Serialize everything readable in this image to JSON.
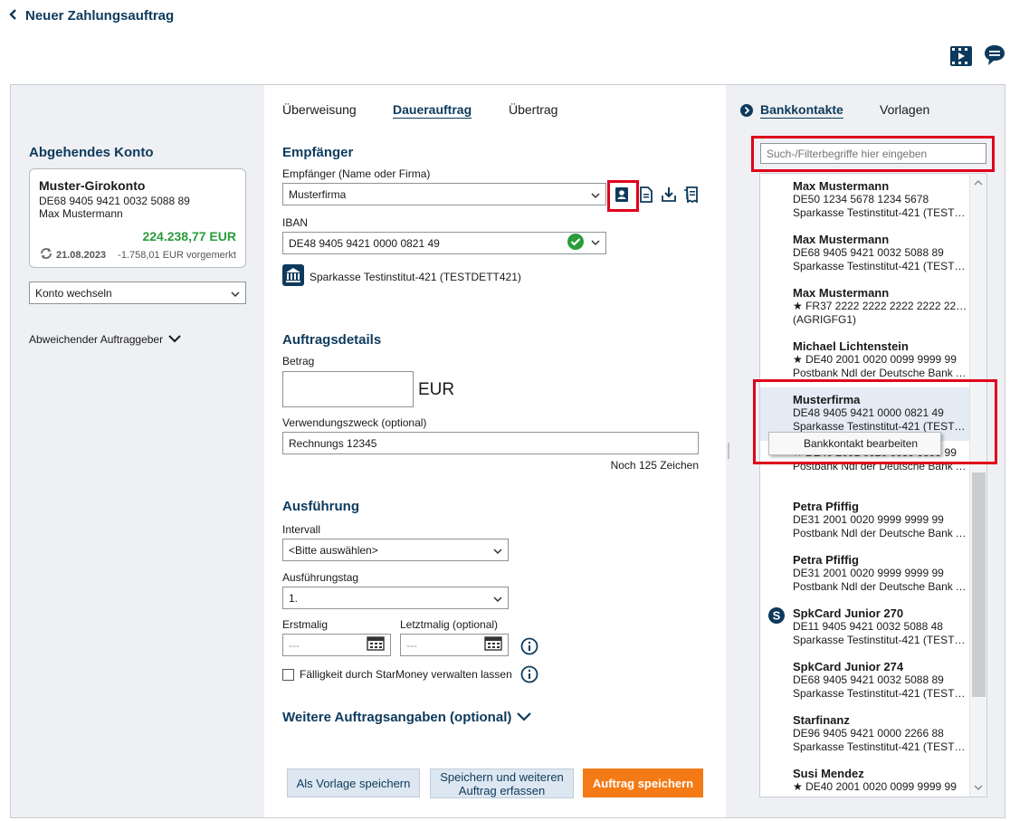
{
  "header": {
    "title": "Neuer Zahlungsauftrag"
  },
  "left": {
    "title": "Abgehendes Konto",
    "account": {
      "name": "Muster-Girokonto",
      "iban": "DE68 9405 9421 0032 5088 89",
      "owner": "Max Mustermann",
      "balance": "224.238,77 EUR",
      "date": "21.08.2023",
      "pending": "-1.758,01 EUR vorgemerkt"
    },
    "switch_label": "Konto wechseln",
    "alt_payer_label": "Abweichender Auftraggeber"
  },
  "tabs": [
    "Überweisung",
    "Dauerauftrag",
    "Übertrag"
  ],
  "recipient": {
    "section_title": "Empfänger",
    "name_label": "Empfänger (Name oder Firma)",
    "name_value": "Musterfirma",
    "iban_label": "IBAN",
    "iban_value": "DE48 9405 9421 0000 0821 49",
    "bank": "Sparkasse Testinstitut-421 (TESTDETT421)"
  },
  "details": {
    "section_title": "Auftragsdetails",
    "amount_label": "Betrag",
    "amount_value": "",
    "currency": "EUR",
    "purpose_label": "Verwendungszweck (optional)",
    "purpose_value": "Rechnungs 12345",
    "chars_left": "Noch 125 Zeichen"
  },
  "execution": {
    "section_title": "Ausführung",
    "interval_label": "Intervall",
    "interval_value": "<Bitte auswählen>",
    "day_label": "Ausführungstag",
    "day_value": "1.",
    "first_label": "Erstmalig",
    "first_value": "---",
    "last_label": "Letztmalig (optional)",
    "last_value": "---",
    "starmoney_label": "Fälligkeit durch StarMoney verwalten lassen"
  },
  "more_label": "Weitere Auftragsangaben (optional)",
  "buttons": {
    "template": "Als Vorlage speichern",
    "save_more_line1": "Speichern und weiteren",
    "save_more_line2": "Auftrag erfassen",
    "save": "Auftrag speichern"
  },
  "right": {
    "tabs": [
      "Bankkontakte",
      "Vorlagen"
    ],
    "search_placeholder": "Such-/Filterbegriffe hier eingeben",
    "contacts": [
      {
        "name": "Max Mustermann",
        "line1": "DE50 1234 5678 1234 5678",
        "line2": "Sparkasse Testinstitut-421 (TESTDETT421)"
      },
      {
        "name": "Max Mustermann",
        "line1": "DE68 9405 9421 0032 5088 89",
        "line2": "Sparkasse Testinstitut-421 (TESTDETT421)"
      },
      {
        "name": "Max Mustermann",
        "line1": "★ FR37 2222 2222 2222 2222 2222 222",
        "line2": "(AGRIGFG1)"
      },
      {
        "name": "Michael Lichtenstein",
        "line1": "★ DE40 2001 0020 0099 9999 99",
        "line2": "Postbank Ndl der Deutsche Bank AG"
      },
      {
        "name": "Musterfirma",
        "line1": "DE48 9405 9421 0000 0821 49",
        "line2": "Sparkasse Testinstitut-421 (TESTDETT421)"
      },
      {
        "name": "",
        "line1": "★ DE40 2001 0020 0099 9999 99",
        "line2": "Postbank Ndl der Deutsche Bank AG"
      },
      {
        "name": "Petra Pfiffig",
        "line1": "DE31 2001 0020 9999 9999 99",
        "line2": "Postbank Ndl der Deutsche Bank AG"
      },
      {
        "name": "Petra Pfiffig",
        "line1": "DE31 2001 0020 9999 9999 99",
        "line2": "Postbank Ndl der Deutsche Bank AG"
      },
      {
        "name": "SpkCard Junior 270",
        "line1": "DE11 9405 9421 0032 5088 48",
        "line2": "Sparkasse Testinstitut-421 (TESTDETT421)"
      },
      {
        "name": "SpkCard Junior 274",
        "line1": "DE68 9405 9421 0032 5088 89",
        "line2": "Sparkasse Testinstitut-421 (TESTDETT421)"
      },
      {
        "name": "Starfinanz",
        "line1": "DE96 9405 9421 0000 2266 88",
        "line2": "Sparkasse Testinstitut-421 (TESTDETT421)"
      },
      {
        "name": "Susi Mendez",
        "line1": "★ DE40 2001 0020 0099 9999 99",
        "line2": ""
      }
    ],
    "context_menu_item": "Bankkontakt bearbeiten"
  },
  "colors": {
    "primary": "#0d3a5c",
    "accent": "#f47a16",
    "positive": "#2a9d3a",
    "highlight": "#e0001b"
  }
}
